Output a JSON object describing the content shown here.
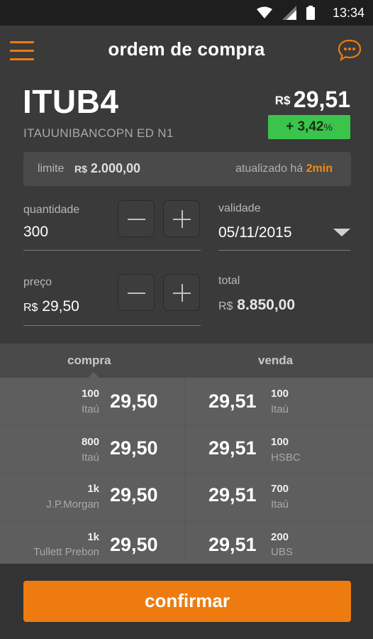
{
  "status_bar": {
    "time": "13:34",
    "icons": [
      "wifi-icon",
      "signal-icon",
      "battery-icon"
    ]
  },
  "header": {
    "title": "ordem de compra",
    "menu_icon": "hamburger-menu-icon",
    "chat_icon": "chat-bubble-icon",
    "accent": "#ee7b10"
  },
  "stock": {
    "code": "ITUB4",
    "name": "ITAUUNIBANCOPN ED N1",
    "currency": "R$",
    "price": "29,51",
    "change": "+ 3,42",
    "change_unit": "%",
    "change_color": "#3ac44b"
  },
  "limit": {
    "label": "limite",
    "currency": "R$",
    "value": "2.000,00",
    "updated_label": "atualizado há",
    "updated_value": "2min"
  },
  "form": {
    "quantity": {
      "label": "quantidade",
      "value": "300"
    },
    "validity": {
      "label": "validade",
      "value": "05/11/2015"
    },
    "price": {
      "label": "preço",
      "currency": "R$",
      "value": "29,50"
    },
    "total": {
      "label": "total",
      "currency": "R$",
      "value": "8.850,00"
    }
  },
  "book": {
    "buy_label": "compra",
    "sell_label": "venda",
    "rows": [
      {
        "buy_qty": "100",
        "buy_broker": "Itaú",
        "buy_price": "29,50",
        "sell_price": "29,51",
        "sell_qty": "100",
        "sell_broker": "Itaú"
      },
      {
        "buy_qty": "800",
        "buy_broker": "Itaú",
        "buy_price": "29,50",
        "sell_price": "29,51",
        "sell_qty": "100",
        "sell_broker": "HSBC"
      },
      {
        "buy_qty": "1k",
        "buy_broker": "J.P.Morgan",
        "buy_price": "29,50",
        "sell_price": "29,51",
        "sell_qty": "700",
        "sell_broker": "Itaú"
      },
      {
        "buy_qty": "1k",
        "buy_broker": "Tullett Prebon",
        "buy_price": "29,50",
        "sell_price": "29,51",
        "sell_qty": "200",
        "sell_broker": "UBS"
      }
    ]
  },
  "footer": {
    "confirm_label": "confirmar"
  }
}
